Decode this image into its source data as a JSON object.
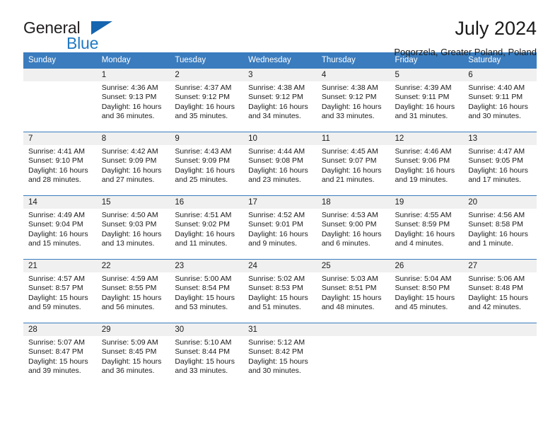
{
  "logo": {
    "word_one": "General",
    "word_two": "Blue",
    "accent_dark": "#231f20",
    "accent_blue": "#1f7ac4"
  },
  "header": {
    "title": "July 2024",
    "subtitle": "Pogorzela, Greater Poland, Poland"
  },
  "theme": {
    "header_blue": "#3a7cbe",
    "daynum_gray": "#f0f0f0",
    "text": "#1a1a1a"
  },
  "weekday_headers": [
    "Sunday",
    "Monday",
    "Tuesday",
    "Wednesday",
    "Thursday",
    "Friday",
    "Saturday"
  ],
  "labels": {
    "sunrise_prefix": "Sunrise:",
    "sunset_prefix": "Sunset:",
    "daylight_prefix": "Daylight:"
  },
  "weeks": [
    [
      {
        "day": "",
        "sunrise": "",
        "sunset": "",
        "daylight_line1": "",
        "daylight_line2": "",
        "blank": true
      },
      {
        "day": "1",
        "sunrise": "Sunrise: 4:36 AM",
        "sunset": "Sunset: 9:13 PM",
        "daylight_line1": "Daylight: 16 hours",
        "daylight_line2": "and 36 minutes."
      },
      {
        "day": "2",
        "sunrise": "Sunrise: 4:37 AM",
        "sunset": "Sunset: 9:12 PM",
        "daylight_line1": "Daylight: 16 hours",
        "daylight_line2": "and 35 minutes."
      },
      {
        "day": "3",
        "sunrise": "Sunrise: 4:38 AM",
        "sunset": "Sunset: 9:12 PM",
        "daylight_line1": "Daylight: 16 hours",
        "daylight_line2": "and 34 minutes."
      },
      {
        "day": "4",
        "sunrise": "Sunrise: 4:38 AM",
        "sunset": "Sunset: 9:12 PM",
        "daylight_line1": "Daylight: 16 hours",
        "daylight_line2": "and 33 minutes."
      },
      {
        "day": "5",
        "sunrise": "Sunrise: 4:39 AM",
        "sunset": "Sunset: 9:11 PM",
        "daylight_line1": "Daylight: 16 hours",
        "daylight_line2": "and 31 minutes."
      },
      {
        "day": "6",
        "sunrise": "Sunrise: 4:40 AM",
        "sunset": "Sunset: 9:11 PM",
        "daylight_line1": "Daylight: 16 hours",
        "daylight_line2": "and 30 minutes."
      }
    ],
    [
      {
        "day": "7",
        "sunrise": "Sunrise: 4:41 AM",
        "sunset": "Sunset: 9:10 PM",
        "daylight_line1": "Daylight: 16 hours",
        "daylight_line2": "and 28 minutes."
      },
      {
        "day": "8",
        "sunrise": "Sunrise: 4:42 AM",
        "sunset": "Sunset: 9:09 PM",
        "daylight_line1": "Daylight: 16 hours",
        "daylight_line2": "and 27 minutes."
      },
      {
        "day": "9",
        "sunrise": "Sunrise: 4:43 AM",
        "sunset": "Sunset: 9:09 PM",
        "daylight_line1": "Daylight: 16 hours",
        "daylight_line2": "and 25 minutes."
      },
      {
        "day": "10",
        "sunrise": "Sunrise: 4:44 AM",
        "sunset": "Sunset: 9:08 PM",
        "daylight_line1": "Daylight: 16 hours",
        "daylight_line2": "and 23 minutes."
      },
      {
        "day": "11",
        "sunrise": "Sunrise: 4:45 AM",
        "sunset": "Sunset: 9:07 PM",
        "daylight_line1": "Daylight: 16 hours",
        "daylight_line2": "and 21 minutes."
      },
      {
        "day": "12",
        "sunrise": "Sunrise: 4:46 AM",
        "sunset": "Sunset: 9:06 PM",
        "daylight_line1": "Daylight: 16 hours",
        "daylight_line2": "and 19 minutes."
      },
      {
        "day": "13",
        "sunrise": "Sunrise: 4:47 AM",
        "sunset": "Sunset: 9:05 PM",
        "daylight_line1": "Daylight: 16 hours",
        "daylight_line2": "and 17 minutes."
      }
    ],
    [
      {
        "day": "14",
        "sunrise": "Sunrise: 4:49 AM",
        "sunset": "Sunset: 9:04 PM",
        "daylight_line1": "Daylight: 16 hours",
        "daylight_line2": "and 15 minutes."
      },
      {
        "day": "15",
        "sunrise": "Sunrise: 4:50 AM",
        "sunset": "Sunset: 9:03 PM",
        "daylight_line1": "Daylight: 16 hours",
        "daylight_line2": "and 13 minutes."
      },
      {
        "day": "16",
        "sunrise": "Sunrise: 4:51 AM",
        "sunset": "Sunset: 9:02 PM",
        "daylight_line1": "Daylight: 16 hours",
        "daylight_line2": "and 11 minutes."
      },
      {
        "day": "17",
        "sunrise": "Sunrise: 4:52 AM",
        "sunset": "Sunset: 9:01 PM",
        "daylight_line1": "Daylight: 16 hours",
        "daylight_line2": "and 9 minutes."
      },
      {
        "day": "18",
        "sunrise": "Sunrise: 4:53 AM",
        "sunset": "Sunset: 9:00 PM",
        "daylight_line1": "Daylight: 16 hours",
        "daylight_line2": "and 6 minutes."
      },
      {
        "day": "19",
        "sunrise": "Sunrise: 4:55 AM",
        "sunset": "Sunset: 8:59 PM",
        "daylight_line1": "Daylight: 16 hours",
        "daylight_line2": "and 4 minutes."
      },
      {
        "day": "20",
        "sunrise": "Sunrise: 4:56 AM",
        "sunset": "Sunset: 8:58 PM",
        "daylight_line1": "Daylight: 16 hours",
        "daylight_line2": "and 1 minute."
      }
    ],
    [
      {
        "day": "21",
        "sunrise": "Sunrise: 4:57 AM",
        "sunset": "Sunset: 8:57 PM",
        "daylight_line1": "Daylight: 15 hours",
        "daylight_line2": "and 59 minutes."
      },
      {
        "day": "22",
        "sunrise": "Sunrise: 4:59 AM",
        "sunset": "Sunset: 8:55 PM",
        "daylight_line1": "Daylight: 15 hours",
        "daylight_line2": "and 56 minutes."
      },
      {
        "day": "23",
        "sunrise": "Sunrise: 5:00 AM",
        "sunset": "Sunset: 8:54 PM",
        "daylight_line1": "Daylight: 15 hours",
        "daylight_line2": "and 53 minutes."
      },
      {
        "day": "24",
        "sunrise": "Sunrise: 5:02 AM",
        "sunset": "Sunset: 8:53 PM",
        "daylight_line1": "Daylight: 15 hours",
        "daylight_line2": "and 51 minutes."
      },
      {
        "day": "25",
        "sunrise": "Sunrise: 5:03 AM",
        "sunset": "Sunset: 8:51 PM",
        "daylight_line1": "Daylight: 15 hours",
        "daylight_line2": "and 48 minutes."
      },
      {
        "day": "26",
        "sunrise": "Sunrise: 5:04 AM",
        "sunset": "Sunset: 8:50 PM",
        "daylight_line1": "Daylight: 15 hours",
        "daylight_line2": "and 45 minutes."
      },
      {
        "day": "27",
        "sunrise": "Sunrise: 5:06 AM",
        "sunset": "Sunset: 8:48 PM",
        "daylight_line1": "Daylight: 15 hours",
        "daylight_line2": "and 42 minutes."
      }
    ],
    [
      {
        "day": "28",
        "sunrise": "Sunrise: 5:07 AM",
        "sunset": "Sunset: 8:47 PM",
        "daylight_line1": "Daylight: 15 hours",
        "daylight_line2": "and 39 minutes."
      },
      {
        "day": "29",
        "sunrise": "Sunrise: 5:09 AM",
        "sunset": "Sunset: 8:45 PM",
        "daylight_line1": "Daylight: 15 hours",
        "daylight_line2": "and 36 minutes."
      },
      {
        "day": "30",
        "sunrise": "Sunrise: 5:10 AM",
        "sunset": "Sunset: 8:44 PM",
        "daylight_line1": "Daylight: 15 hours",
        "daylight_line2": "and 33 minutes."
      },
      {
        "day": "31",
        "sunrise": "Sunrise: 5:12 AM",
        "sunset": "Sunset: 8:42 PM",
        "daylight_line1": "Daylight: 15 hours",
        "daylight_line2": "and 30 minutes."
      },
      {
        "day": "",
        "sunrise": "",
        "sunset": "",
        "daylight_line1": "",
        "daylight_line2": "",
        "blank": true
      },
      {
        "day": "",
        "sunrise": "",
        "sunset": "",
        "daylight_line1": "",
        "daylight_line2": "",
        "blank": true
      },
      {
        "day": "",
        "sunrise": "",
        "sunset": "",
        "daylight_line1": "",
        "daylight_line2": "",
        "blank": true
      }
    ]
  ]
}
